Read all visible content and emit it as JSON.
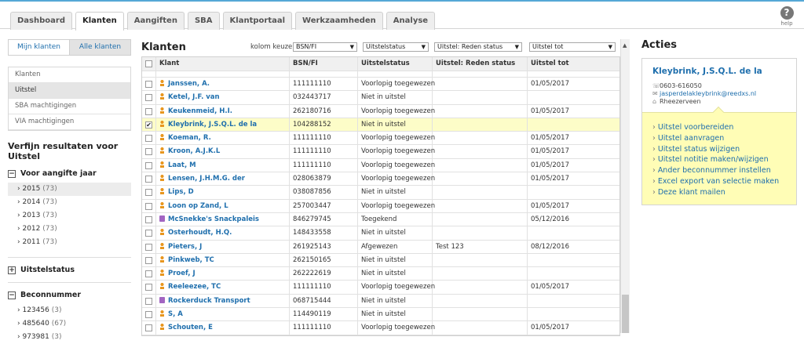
{
  "nav": {
    "tabs": [
      "Dashboard",
      "Klanten",
      "Aangiften",
      "SBA",
      "Klantportaal",
      "Werkzaamheden",
      "Analyse"
    ],
    "active": "Klanten",
    "help_label": "help"
  },
  "left": {
    "toggle": [
      "Mijn klanten",
      "Alle klanten"
    ],
    "menu": [
      "Klanten",
      "Uitstel",
      "SBA machtigingen",
      "VIA machtigingen"
    ],
    "refine_title": "Verfijn resultaten voor Uitstel",
    "facets": {
      "year": {
        "title": "Voor aangifte jaar",
        "items": [
          {
            "label": "2015",
            "count": "(73)"
          },
          {
            "label": "2014",
            "count": "(73)"
          },
          {
            "label": "2013",
            "count": "(73)"
          },
          {
            "label": "2012",
            "count": "(73)"
          },
          {
            "label": "2011",
            "count": "(73)"
          }
        ]
      },
      "status": {
        "title": "Uitstelstatus"
      },
      "beconnummer": {
        "title": "Beconnummer",
        "items": [
          {
            "label": "123456",
            "count": "(3)"
          },
          {
            "label": "485640",
            "count": "(67)"
          },
          {
            "label": "973981",
            "count": "(3)"
          }
        ]
      }
    }
  },
  "center": {
    "title": "Klanten",
    "kolom_label": "kolom keuze:",
    "selects": [
      "BSN/FI",
      "Uitstelstatus",
      "Uitstel: Reden status",
      "Uitstel tot"
    ],
    "columns": [
      "Klant",
      "BSN/FI",
      "Uitstelstatus",
      "Uitstel: Reden status",
      "Uitstel tot"
    ],
    "rows": [
      {
        "icon": "person",
        "name": "",
        "bsn": "",
        "status": "",
        "reden": "",
        "tot": ""
      },
      {
        "icon": "person",
        "name": "Janssen, A.",
        "bsn": "111111110",
        "status": "Voorlopig toegewezen",
        "reden": "",
        "tot": "01/05/2017"
      },
      {
        "icon": "person",
        "name": "Ketel, J.F. van",
        "bsn": "032443717",
        "status": "Niet in uitstel",
        "reden": "",
        "tot": ""
      },
      {
        "icon": "person",
        "name": "Keukenmeid, H.I.",
        "bsn": "262180716",
        "status": "Voorlopig toegewezen",
        "reden": "",
        "tot": "01/05/2017"
      },
      {
        "icon": "person",
        "name": "Kleybrink, J.S.Q.L. de la",
        "bsn": "104288152",
        "status": "Niet in uitstel",
        "reden": "",
        "tot": "",
        "checked": true
      },
      {
        "icon": "person",
        "name": "Koeman, R.",
        "bsn": "111111110",
        "status": "Voorlopig toegewezen",
        "reden": "",
        "tot": "01/05/2017"
      },
      {
        "icon": "person",
        "name": "Kroon, A.J.K.L",
        "bsn": "111111110",
        "status": "Voorlopig toegewezen",
        "reden": "",
        "tot": "01/05/2017"
      },
      {
        "icon": "person",
        "name": "Laat, M",
        "bsn": "111111110",
        "status": "Voorlopig toegewezen",
        "reden": "",
        "tot": "01/05/2017"
      },
      {
        "icon": "person",
        "name": "Lensen, J.H.M.G. der",
        "bsn": "028063879",
        "status": "Voorlopig toegewezen",
        "reden": "",
        "tot": "01/05/2017"
      },
      {
        "icon": "person",
        "name": "Lips, D",
        "bsn": "038087856",
        "status": "Niet in uitstel",
        "reden": "",
        "tot": ""
      },
      {
        "icon": "person",
        "name": "Loon op Zand, L",
        "bsn": "257003447",
        "status": "Voorlopig toegewezen",
        "reden": "",
        "tot": "01/05/2017"
      },
      {
        "icon": "company",
        "name": "McSnekke's Snackpaleis",
        "bsn": "846279745",
        "status": "Toegekend",
        "reden": "",
        "tot": "05/12/2016"
      },
      {
        "icon": "person",
        "name": "Osterhoudt, H.Q.",
        "bsn": "148433558",
        "status": "Niet in uitstel",
        "reden": "",
        "tot": ""
      },
      {
        "icon": "person",
        "name": "Pieters, J",
        "bsn": "261925143",
        "status": "Afgewezen",
        "reden": "Test 123",
        "tot": "08/12/2016"
      },
      {
        "icon": "person",
        "name": "Pinkweb, TC",
        "bsn": "262150165",
        "status": "Niet in uitstel",
        "reden": "",
        "tot": ""
      },
      {
        "icon": "person",
        "name": "Proef, J",
        "bsn": "262222619",
        "status": "Niet in uitstel",
        "reden": "",
        "tot": ""
      },
      {
        "icon": "person",
        "name": "Reeleezee, TC",
        "bsn": "111111110",
        "status": "Voorlopig toegewezen",
        "reden": "",
        "tot": "01/05/2017"
      },
      {
        "icon": "company",
        "name": "Rockerduck Transport",
        "bsn": "068715444",
        "status": "Niet in uitstel",
        "reden": "",
        "tot": ""
      },
      {
        "icon": "person",
        "name": "S, A",
        "bsn": "114490119",
        "status": "Niet in uitstel",
        "reden": "",
        "tot": ""
      },
      {
        "icon": "person",
        "name": "Schouten, E",
        "bsn": "111111110",
        "status": "Voorlopig toegewezen",
        "reden": "",
        "tot": "01/05/2017"
      }
    ]
  },
  "right": {
    "title": "Acties",
    "client": {
      "name": "Kleybrink, J.S.Q.L. de la",
      "phone": "0603-616050",
      "email": "jasperdelakleybrink@reedxs.nl",
      "city": "Rheezerveen"
    },
    "actions": [
      "Uitstel voorbereiden",
      "Uitstel aanvragen",
      "Uitstel status wijzigen",
      "Uitstel notitie maken/wijzigen",
      "Ander beconnummer instellen",
      "Excel export van selectie maken",
      "Deze klant mailen"
    ]
  }
}
